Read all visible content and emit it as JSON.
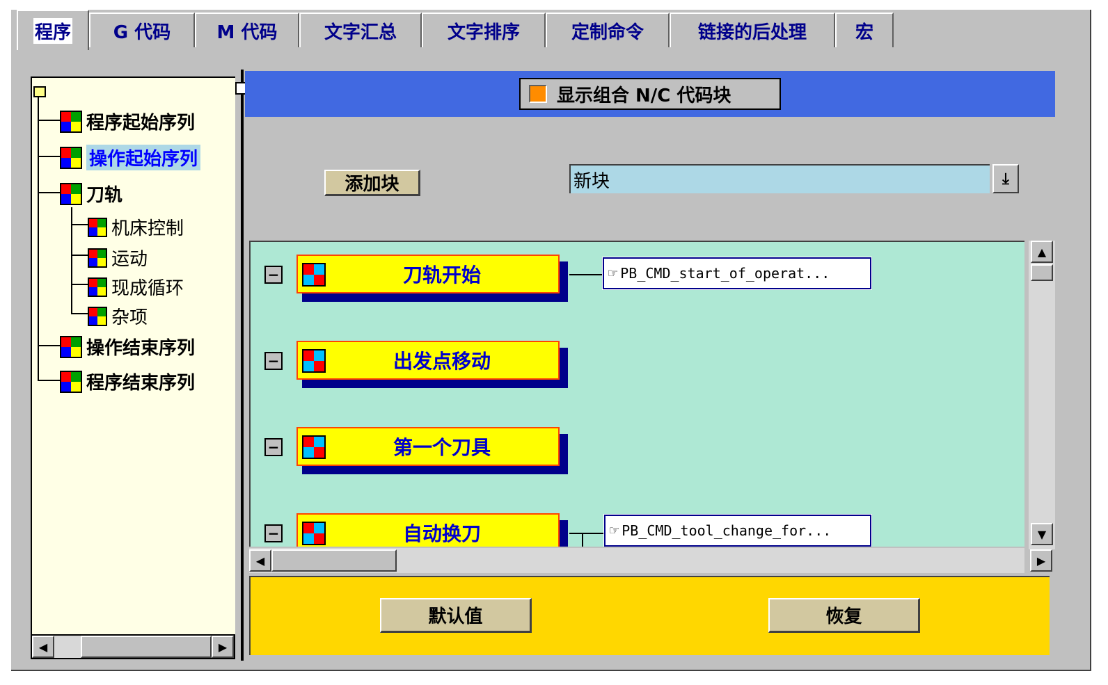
{
  "tabs": [
    {
      "label": "程序",
      "active": true
    },
    {
      "label": "G 代码"
    },
    {
      "label": "M 代码"
    },
    {
      "label": "文字汇总"
    },
    {
      "label": "文字排序"
    },
    {
      "label": "定制命令"
    },
    {
      "label": "链接的后处理"
    },
    {
      "label": "宏"
    }
  ],
  "tree": {
    "items": [
      {
        "label": "程序起始序列",
        "level": 1
      },
      {
        "label": "操作起始序列",
        "level": 1,
        "selected": true
      },
      {
        "label": "刀轨",
        "level": 1
      },
      {
        "label": "机床控制",
        "level": 2
      },
      {
        "label": "运动",
        "level": 2
      },
      {
        "label": "现成循环",
        "level": 2
      },
      {
        "label": "杂项",
        "level": 2
      },
      {
        "label": "操作结束序列",
        "level": 1
      },
      {
        "label": "程序结束序列",
        "level": 1
      }
    ]
  },
  "toolbar": {
    "show_combined_label": "显示组合 N/C 代码块",
    "add_block_label": "添加块",
    "new_block_value": "新块"
  },
  "blocks": [
    {
      "label": "刀轨开始",
      "command": "PB_CMD_start_of_operat..."
    },
    {
      "label": "出发点移动",
      "command": ""
    },
    {
      "label": "第一个刀具",
      "command": ""
    },
    {
      "label": "自动换刀",
      "command": "PB_CMD_tool_change_for..."
    }
  ],
  "footer": {
    "default_label": "默认值",
    "restore_label": "恢复"
  },
  "colors": {
    "blue_bar": "#4169e1",
    "canvas_bg": "#aee8d4",
    "block_fill": "#ffff00",
    "block_text": "#0000cd",
    "footer_bg": "#ffd700",
    "tree_bg": "#ffffe6",
    "selected_bg": "#add8e6"
  },
  "icons": {
    "tree_node": "color-cube-icon",
    "block": "puzzle-icon",
    "command": "hand-pointer-icon",
    "root": "folder-icon"
  }
}
